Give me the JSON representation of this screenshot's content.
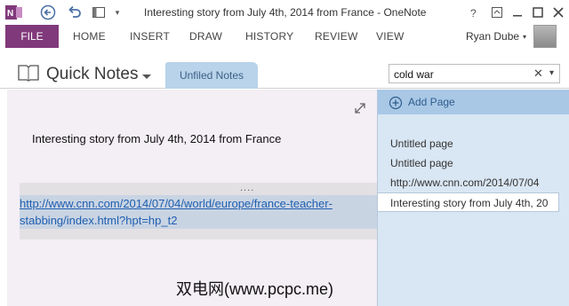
{
  "window": {
    "title": "Interesting story from July 4th, 2014 from France - OneNote"
  },
  "ribbon": {
    "file_label": "FILE",
    "tabs": [
      "HOME",
      "INSERT",
      "DRAW",
      "HISTORY",
      "REVIEW",
      "VIEW"
    ],
    "user_name": "Ryan Dube"
  },
  "notebook": {
    "name": "Quick Notes",
    "section_tab": "Unfiled Notes"
  },
  "search": {
    "value": "cold war"
  },
  "page": {
    "title": "Interesting story from July 4th, 2014 from France",
    "container_grip": "....",
    "link_line1": "http://www.cnn.com/2014/07/04/world/europe/france-teacher-",
    "link_line2": "stabbing/index.html?hpt=hp_t2"
  },
  "pagelist": {
    "add_page_label": "Add Page",
    "items": [
      "Untitled page",
      "Untitled page",
      "http://www.cnn.com/2014/07/04",
      "Interesting story from July 4th, 20"
    ]
  },
  "watermark": "双电网(www.pcpc.me)",
  "colors": {
    "file_tab": "#80397b",
    "section_tab": "#b9d3ea",
    "page_bg": "#f4eef5",
    "pagelist_bg": "#d9e6f3",
    "link": "#1f5fb0"
  }
}
